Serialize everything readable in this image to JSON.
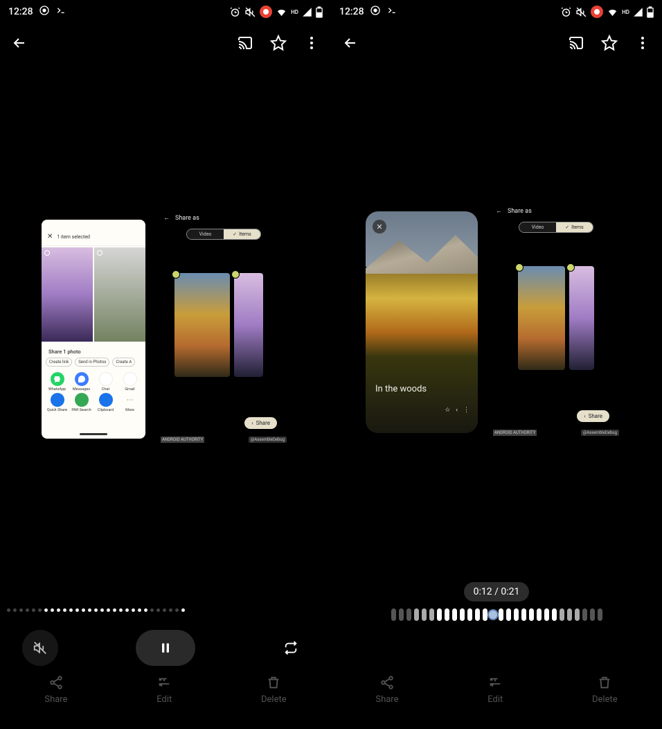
{
  "status": {
    "time": "12:28",
    "hd_label": "HD"
  },
  "app_bar": {
    "back": "←",
    "cast": "cast",
    "favorite": "star",
    "more": "⋮"
  },
  "player": {
    "time_badge": "0:12 / 0:21"
  },
  "preview": {
    "caption": "In the woods"
  },
  "share_sheet": {
    "title": "1 item selected",
    "share_label": "Share 1 photo",
    "chips": [
      "Create link",
      "Send in Photos",
      "Create A"
    ],
    "apps": [
      "WhatsApp",
      "Messages",
      "Chat",
      "Gmail",
      "Quick Share",
      "PAR Search",
      "Clipboard",
      "More"
    ]
  },
  "share_as": {
    "title": "Share as",
    "seg_video": "Video",
    "seg_items": "Items",
    "share_btn": "Share"
  },
  "watermark": {
    "authority": "ANDROID AUTHORITY",
    "handle": "@AssembleDebug"
  },
  "actions": {
    "share": "Share",
    "edit": "Edit",
    "delete": "Delete"
  }
}
